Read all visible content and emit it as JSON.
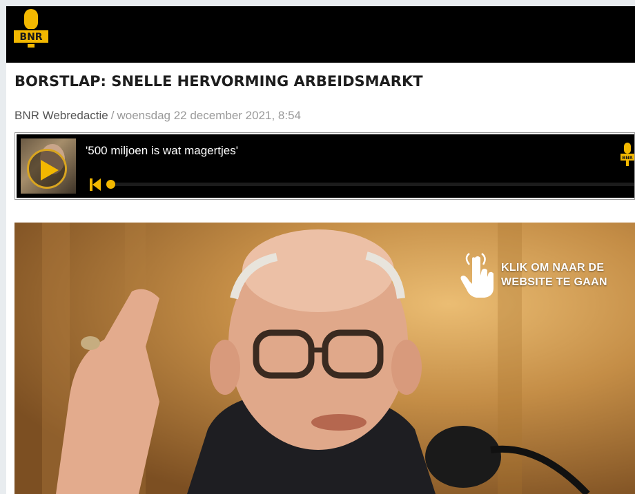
{
  "brand": {
    "logo_text": "BNR",
    "accent": "#f3b800"
  },
  "article": {
    "title": "BORSTLAP: SNELLE HERVORMING ARBEIDSMARKT",
    "author": "BNR Webredactie",
    "separator": "/",
    "date": "woensdag 22 december 2021, 8:54"
  },
  "player": {
    "episode_title": "'500 miljoen is wat magertjes'",
    "progress": 0.0,
    "icons": [
      "play-icon",
      "rewind-icon",
      "bnr-microphone-icon"
    ]
  },
  "hero": {
    "cta_line1": "KLIK OM NAAR DE",
    "cta_line2": "WEBSITE TE GAAN",
    "cta_icon": "hand-pointer-icon"
  }
}
